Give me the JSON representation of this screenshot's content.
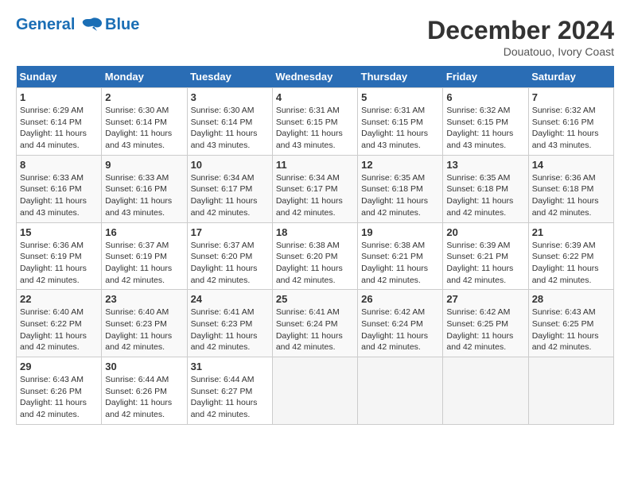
{
  "header": {
    "logo_line1": "General",
    "logo_line2": "Blue",
    "month_title": "December 2024",
    "location": "Douatouo, Ivory Coast"
  },
  "days_of_week": [
    "Sunday",
    "Monday",
    "Tuesday",
    "Wednesday",
    "Thursday",
    "Friday",
    "Saturday"
  ],
  "weeks": [
    [
      {
        "day": "1",
        "sunrise": "6:29 AM",
        "sunset": "6:14 PM",
        "daylight": "11 hours and 44 minutes."
      },
      {
        "day": "2",
        "sunrise": "6:30 AM",
        "sunset": "6:14 PM",
        "daylight": "11 hours and 43 minutes."
      },
      {
        "day": "3",
        "sunrise": "6:30 AM",
        "sunset": "6:14 PM",
        "daylight": "11 hours and 43 minutes."
      },
      {
        "day": "4",
        "sunrise": "6:31 AM",
        "sunset": "6:15 PM",
        "daylight": "11 hours and 43 minutes."
      },
      {
        "day": "5",
        "sunrise": "6:31 AM",
        "sunset": "6:15 PM",
        "daylight": "11 hours and 43 minutes."
      },
      {
        "day": "6",
        "sunrise": "6:32 AM",
        "sunset": "6:15 PM",
        "daylight": "11 hours and 43 minutes."
      },
      {
        "day": "7",
        "sunrise": "6:32 AM",
        "sunset": "6:16 PM",
        "daylight": "11 hours and 43 minutes."
      }
    ],
    [
      {
        "day": "8",
        "sunrise": "6:33 AM",
        "sunset": "6:16 PM",
        "daylight": "11 hours and 43 minutes."
      },
      {
        "day": "9",
        "sunrise": "6:33 AM",
        "sunset": "6:16 PM",
        "daylight": "11 hours and 43 minutes."
      },
      {
        "day": "10",
        "sunrise": "6:34 AM",
        "sunset": "6:17 PM",
        "daylight": "11 hours and 42 minutes."
      },
      {
        "day": "11",
        "sunrise": "6:34 AM",
        "sunset": "6:17 PM",
        "daylight": "11 hours and 42 minutes."
      },
      {
        "day": "12",
        "sunrise": "6:35 AM",
        "sunset": "6:18 PM",
        "daylight": "11 hours and 42 minutes."
      },
      {
        "day": "13",
        "sunrise": "6:35 AM",
        "sunset": "6:18 PM",
        "daylight": "11 hours and 42 minutes."
      },
      {
        "day": "14",
        "sunrise": "6:36 AM",
        "sunset": "6:18 PM",
        "daylight": "11 hours and 42 minutes."
      }
    ],
    [
      {
        "day": "15",
        "sunrise": "6:36 AM",
        "sunset": "6:19 PM",
        "daylight": "11 hours and 42 minutes."
      },
      {
        "day": "16",
        "sunrise": "6:37 AM",
        "sunset": "6:19 PM",
        "daylight": "11 hours and 42 minutes."
      },
      {
        "day": "17",
        "sunrise": "6:37 AM",
        "sunset": "6:20 PM",
        "daylight": "11 hours and 42 minutes."
      },
      {
        "day": "18",
        "sunrise": "6:38 AM",
        "sunset": "6:20 PM",
        "daylight": "11 hours and 42 minutes."
      },
      {
        "day": "19",
        "sunrise": "6:38 AM",
        "sunset": "6:21 PM",
        "daylight": "11 hours and 42 minutes."
      },
      {
        "day": "20",
        "sunrise": "6:39 AM",
        "sunset": "6:21 PM",
        "daylight": "11 hours and 42 minutes."
      },
      {
        "day": "21",
        "sunrise": "6:39 AM",
        "sunset": "6:22 PM",
        "daylight": "11 hours and 42 minutes."
      }
    ],
    [
      {
        "day": "22",
        "sunrise": "6:40 AM",
        "sunset": "6:22 PM",
        "daylight": "11 hours and 42 minutes."
      },
      {
        "day": "23",
        "sunrise": "6:40 AM",
        "sunset": "6:23 PM",
        "daylight": "11 hours and 42 minutes."
      },
      {
        "day": "24",
        "sunrise": "6:41 AM",
        "sunset": "6:23 PM",
        "daylight": "11 hours and 42 minutes."
      },
      {
        "day": "25",
        "sunrise": "6:41 AM",
        "sunset": "6:24 PM",
        "daylight": "11 hours and 42 minutes."
      },
      {
        "day": "26",
        "sunrise": "6:42 AM",
        "sunset": "6:24 PM",
        "daylight": "11 hours and 42 minutes."
      },
      {
        "day": "27",
        "sunrise": "6:42 AM",
        "sunset": "6:25 PM",
        "daylight": "11 hours and 42 minutes."
      },
      {
        "day": "28",
        "sunrise": "6:43 AM",
        "sunset": "6:25 PM",
        "daylight": "11 hours and 42 minutes."
      }
    ],
    [
      {
        "day": "29",
        "sunrise": "6:43 AM",
        "sunset": "6:26 PM",
        "daylight": "11 hours and 42 minutes."
      },
      {
        "day": "30",
        "sunrise": "6:44 AM",
        "sunset": "6:26 PM",
        "daylight": "11 hours and 42 minutes."
      },
      {
        "day": "31",
        "sunrise": "6:44 AM",
        "sunset": "6:27 PM",
        "daylight": "11 hours and 42 minutes."
      },
      null,
      null,
      null,
      null
    ]
  ]
}
